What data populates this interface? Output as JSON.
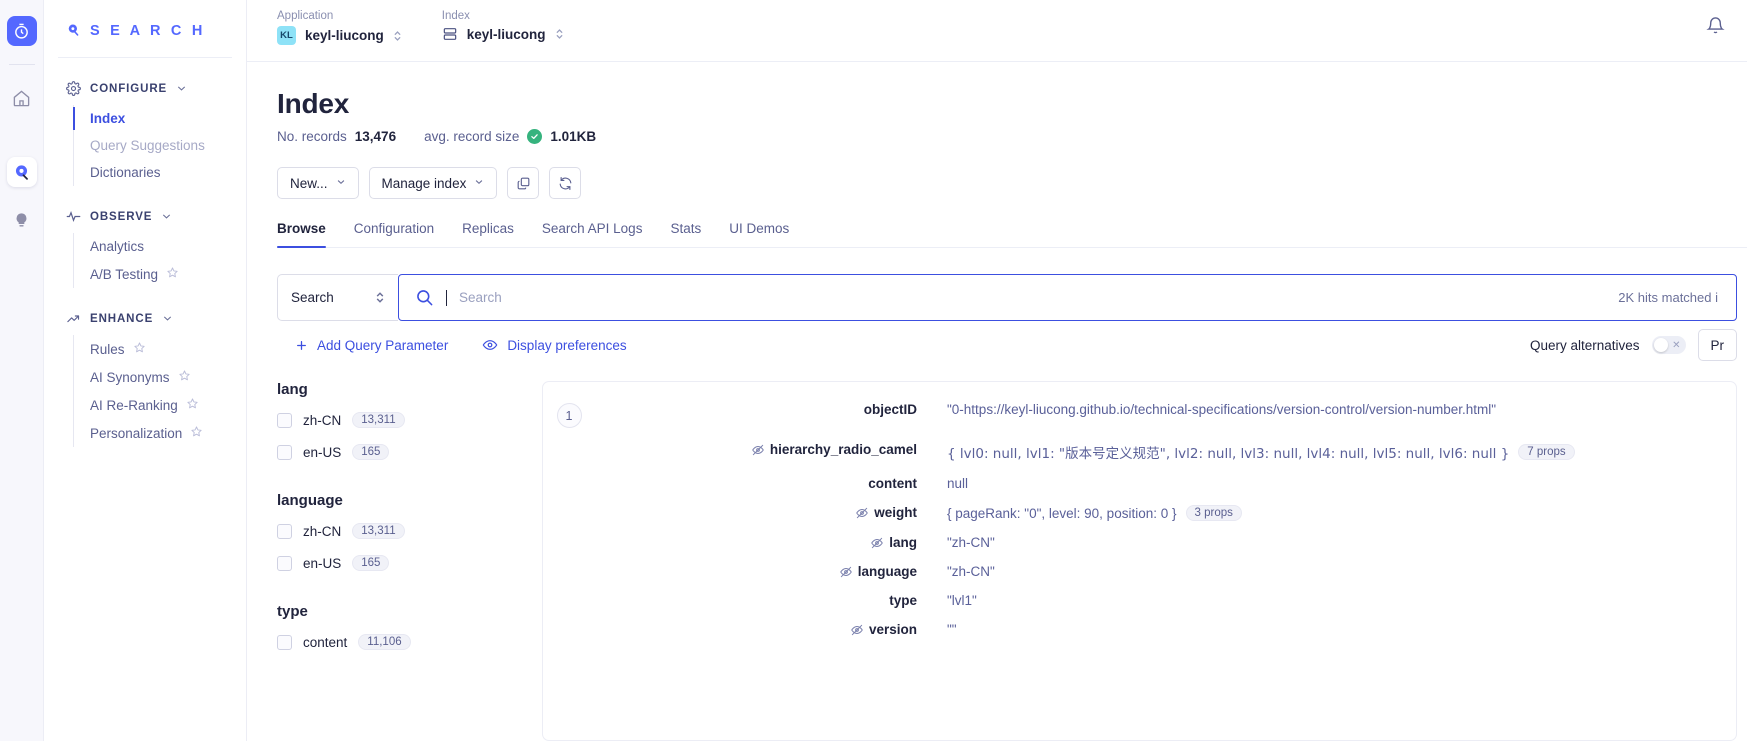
{
  "rail": {
    "logo_icon": "stopwatch-icon",
    "items": [
      {
        "icon": "home-icon",
        "active": false
      },
      {
        "icon": "search-marker-icon",
        "active": true
      },
      {
        "icon": "lightbulb-icon",
        "active": false
      }
    ]
  },
  "sidebar": {
    "brand": "S E A R C H",
    "brand_icon": "algolia-logo-icon",
    "groups": [
      {
        "title": "CONFIGURE",
        "icon": "gear-icon",
        "items": [
          {
            "label": "Index",
            "active": true,
            "muted": false,
            "star": false
          },
          {
            "label": "Query Suggestions",
            "active": false,
            "muted": true,
            "star": false
          },
          {
            "label": "Dictionaries",
            "active": false,
            "muted": false,
            "star": false
          }
        ]
      },
      {
        "title": "OBSERVE",
        "icon": "pulse-icon",
        "items": [
          {
            "label": "Analytics",
            "active": false,
            "muted": false,
            "star": false
          },
          {
            "label": "A/B Testing",
            "active": false,
            "muted": false,
            "star": true
          }
        ]
      },
      {
        "title": "ENHANCE",
        "icon": "trend-up-icon",
        "items": [
          {
            "label": "Rules",
            "active": false,
            "muted": false,
            "star": true
          },
          {
            "label": "AI Synonyms",
            "active": false,
            "muted": false,
            "star": true
          },
          {
            "label": "AI Re-Ranking",
            "active": false,
            "muted": false,
            "star": true
          },
          {
            "label": "Personalization",
            "active": false,
            "muted": false,
            "star": true
          }
        ]
      }
    ]
  },
  "topbar": {
    "application_label": "Application",
    "application_value": "keyl-liucong",
    "application_initials": "KL",
    "index_label": "Index",
    "index_value": "keyl-liucong",
    "bell_icon": "bell-icon"
  },
  "page": {
    "title": "Index",
    "records_label": "No. records",
    "records_value": "13,476",
    "avg_size_label": "avg. record size",
    "avg_size_value": "1.01KB"
  },
  "toolbar": {
    "new_label": "New...",
    "manage_label": "Manage index",
    "copy_icon": "copy-icon",
    "refresh_icon": "refresh-icon"
  },
  "tabs": [
    {
      "label": "Browse",
      "active": true
    },
    {
      "label": "Configuration",
      "active": false
    },
    {
      "label": "Replicas",
      "active": false
    },
    {
      "label": "Search API Logs",
      "active": false
    },
    {
      "label": "Stats",
      "active": false
    },
    {
      "label": "UI Demos",
      "active": false
    }
  ],
  "search": {
    "mode_value": "Search",
    "search_icon": "search-icon",
    "placeholder": "Search",
    "value": "",
    "hits_text": "2K hits matched i"
  },
  "query_tools": {
    "add_param_label": "Add Query Parameter",
    "add_param_icon": "plus-icon",
    "display_prefs_label": "Display preferences",
    "display_prefs_icon": "eye-icon",
    "query_alternatives_label": "Query alternatives",
    "query_alternatives_on": false,
    "right_button_label": "Pr"
  },
  "facets": [
    {
      "name": "lang",
      "values": [
        {
          "label": "zh-CN",
          "count": "13,311",
          "checked": false
        },
        {
          "label": "en-US",
          "count": "165",
          "checked": false
        }
      ]
    },
    {
      "name": "language",
      "values": [
        {
          "label": "zh-CN",
          "count": "13,311",
          "checked": false
        },
        {
          "label": "en-US",
          "count": "165",
          "checked": false
        }
      ]
    },
    {
      "name": "type",
      "values": [
        {
          "label": "content",
          "count": "11,106",
          "checked": false
        }
      ]
    }
  ],
  "record": {
    "number": "1",
    "fields": [
      {
        "key": "objectID",
        "value": "\"0-https://keyl-liucong.github.io/technical-specifications/version-control/version-number.html\"",
        "hidden_icon": false,
        "props": ""
      },
      {
        "key": "hierarchy_radio_camel",
        "value": "{ lvl0: null, lvl1: \"版本号定义规范\", lvl2: null, lvl3: null, lvl4: null, lvl5: null, lvl6: null }",
        "hidden_icon": true,
        "props": "7 props"
      },
      {
        "key": "content",
        "value": "null",
        "hidden_icon": false,
        "props": ""
      },
      {
        "key": "weight",
        "value": "{ pageRank: \"0\", level: 90, position: 0 }",
        "hidden_icon": true,
        "props": "3 props"
      },
      {
        "key": "lang",
        "value": "\"zh-CN\"",
        "hidden_icon": true,
        "props": ""
      },
      {
        "key": "language",
        "value": "\"zh-CN\"",
        "hidden_icon": true,
        "props": ""
      },
      {
        "key": "type",
        "value": "\"lvl1\"",
        "hidden_icon": false,
        "props": ""
      },
      {
        "key": "version",
        "value": "\"\"",
        "hidden_icon": true,
        "props": ""
      }
    ]
  },
  "colors": {
    "accent": "#3c4fe0",
    "brand": "#5468ff",
    "ok": "#36b37e"
  }
}
